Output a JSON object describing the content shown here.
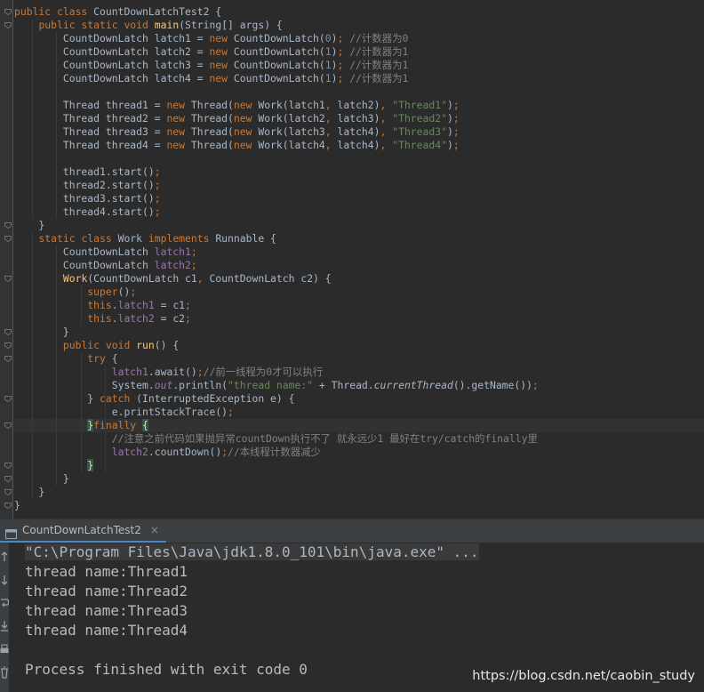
{
  "editor": {
    "lines": [
      [
        [
          "kw",
          "public class "
        ],
        [
          "t",
          "CountDownLatchTest2 {"
        ]
      ],
      [
        [
          "t",
          "    "
        ],
        [
          "kw",
          "public static void "
        ],
        [
          "fn",
          "main"
        ],
        [
          "t",
          "(String[] args) {"
        ]
      ],
      [
        [
          "t",
          "        CountDownLatch latch1 = "
        ],
        [
          "kw",
          "new "
        ],
        [
          "t",
          "CountDownLatch("
        ],
        [
          "num",
          "0"
        ],
        [
          "t",
          ")"
        ],
        [
          "kw",
          "; "
        ],
        [
          "cm",
          "//计数器为0"
        ]
      ],
      [
        [
          "t",
          "        CountDownLatch latch2 = "
        ],
        [
          "kw",
          "new "
        ],
        [
          "t",
          "CountDownLatch("
        ],
        [
          "num",
          "1"
        ],
        [
          "t",
          ")"
        ],
        [
          "kw",
          "; "
        ],
        [
          "cm",
          "//计数器为1"
        ]
      ],
      [
        [
          "t",
          "        CountDownLatch latch3 = "
        ],
        [
          "kw",
          "new "
        ],
        [
          "t",
          "CountDownLatch("
        ],
        [
          "num",
          "1"
        ],
        [
          "t",
          ")"
        ],
        [
          "kw",
          "; "
        ],
        [
          "cm",
          "//计数器为1"
        ]
      ],
      [
        [
          "t",
          "        CountDownLatch latch4 = "
        ],
        [
          "kw",
          "new "
        ],
        [
          "t",
          "CountDownLatch("
        ],
        [
          "num",
          "1"
        ],
        [
          "t",
          ")"
        ],
        [
          "kw",
          "; "
        ],
        [
          "cm",
          "//计数器为1"
        ]
      ],
      [],
      [
        [
          "t",
          "        Thread thread1 = "
        ],
        [
          "kw",
          "new "
        ],
        [
          "t",
          "Thread("
        ],
        [
          "kw",
          "new "
        ],
        [
          "t",
          "Work(latch1"
        ],
        [
          "kw",
          ", "
        ],
        [
          "t",
          "latch2)"
        ],
        [
          "kw",
          ", "
        ],
        [
          "str",
          "\"Thread1\""
        ],
        [
          "t",
          ")"
        ],
        [
          "kw",
          ";"
        ]
      ],
      [
        [
          "t",
          "        Thread thread2 = "
        ],
        [
          "kw",
          "new "
        ],
        [
          "t",
          "Thread("
        ],
        [
          "kw",
          "new "
        ],
        [
          "t",
          "Work(latch2"
        ],
        [
          "kw",
          ", "
        ],
        [
          "t",
          "latch3)"
        ],
        [
          "kw",
          ", "
        ],
        [
          "str",
          "\"Thread2\""
        ],
        [
          "t",
          ")"
        ],
        [
          "kw",
          ";"
        ]
      ],
      [
        [
          "t",
          "        Thread thread3 = "
        ],
        [
          "kw",
          "new "
        ],
        [
          "t",
          "Thread("
        ],
        [
          "kw",
          "new "
        ],
        [
          "t",
          "Work(latch3"
        ],
        [
          "kw",
          ", "
        ],
        [
          "t",
          "latch4)"
        ],
        [
          "kw",
          ", "
        ],
        [
          "str",
          "\"Thread3\""
        ],
        [
          "t",
          ")"
        ],
        [
          "kw",
          ";"
        ]
      ],
      [
        [
          "t",
          "        Thread thread4 = "
        ],
        [
          "kw",
          "new "
        ],
        [
          "t",
          "Thread("
        ],
        [
          "kw",
          "new "
        ],
        [
          "t",
          "Work(latch4"
        ],
        [
          "kw",
          ", "
        ],
        [
          "t",
          "latch4)"
        ],
        [
          "kw",
          ", "
        ],
        [
          "str",
          "\"Thread4\""
        ],
        [
          "t",
          ")"
        ],
        [
          "kw",
          ";"
        ]
      ],
      [],
      [
        [
          "t",
          "        thread1.start()"
        ],
        [
          "kw",
          ";"
        ]
      ],
      [
        [
          "t",
          "        thread2.start()"
        ],
        [
          "kw",
          ";"
        ]
      ],
      [
        [
          "t",
          "        thread3.start()"
        ],
        [
          "kw",
          ";"
        ]
      ],
      [
        [
          "t",
          "        thread4.start()"
        ],
        [
          "kw",
          ";"
        ]
      ],
      [
        [
          "t",
          "    }"
        ]
      ],
      [
        [
          "t",
          "    "
        ],
        [
          "kw",
          "static class "
        ],
        [
          "t",
          "Work "
        ],
        [
          "kw",
          "implements "
        ],
        [
          "t",
          "Runnable {"
        ]
      ],
      [
        [
          "t",
          "        CountDownLatch "
        ],
        [
          "fld",
          "latch1"
        ],
        [
          "kw",
          ";"
        ]
      ],
      [
        [
          "t",
          "        CountDownLatch "
        ],
        [
          "fld",
          "latch2"
        ],
        [
          "kw",
          ";"
        ]
      ],
      [
        [
          "t",
          "        "
        ],
        [
          "fn",
          "Work"
        ],
        [
          "t",
          "(CountDownLatch c1"
        ],
        [
          "kw",
          ", "
        ],
        [
          "t",
          "CountDownLatch c2) {"
        ]
      ],
      [
        [
          "t",
          "            "
        ],
        [
          "kw",
          "super"
        ],
        [
          "t",
          "()"
        ],
        [
          "kw",
          ";"
        ]
      ],
      [
        [
          "t",
          "            "
        ],
        [
          "kw",
          "this"
        ],
        [
          "t",
          "."
        ],
        [
          "fld",
          "latch1 "
        ],
        [
          "t",
          "= c1"
        ],
        [
          "kw",
          ";"
        ]
      ],
      [
        [
          "t",
          "            "
        ],
        [
          "kw",
          "this"
        ],
        [
          "t",
          "."
        ],
        [
          "fld",
          "latch2 "
        ],
        [
          "t",
          "= c2"
        ],
        [
          "kw",
          ";"
        ]
      ],
      [
        [
          "t",
          "        }"
        ]
      ],
      [
        [
          "t",
          "        "
        ],
        [
          "kw",
          "public void "
        ],
        [
          "fn",
          "run"
        ],
        [
          "t",
          "() {"
        ]
      ],
      [
        [
          "t",
          "            "
        ],
        [
          "kw",
          "try "
        ],
        [
          "t",
          "{"
        ]
      ],
      [
        [
          "t",
          "                "
        ],
        [
          "fld",
          "latch1"
        ],
        [
          "t",
          ".await()"
        ],
        [
          "kw",
          ";"
        ],
        [
          "cm",
          "//前一线程为0才可以执行"
        ]
      ],
      [
        [
          "t",
          "                System."
        ],
        [
          "stat",
          "out"
        ],
        [
          "t",
          ".println("
        ],
        [
          "str",
          "\"thread name:\" "
        ],
        [
          "t",
          "+ Thread."
        ],
        [
          "it",
          "currentThread"
        ],
        [
          "t",
          "().getName())"
        ],
        [
          "kw",
          ";"
        ]
      ],
      [
        [
          "t",
          "            } "
        ],
        [
          "kw",
          "catch "
        ],
        [
          "t",
          "(InterruptedException e) {"
        ]
      ],
      [
        [
          "t",
          "                e.printStackTrace()"
        ],
        [
          "kw",
          ";"
        ]
      ],
      [
        [
          "t",
          "            "
        ],
        [
          "brace",
          "}"
        ],
        [
          "kw",
          "finally "
        ],
        [
          "brace",
          "{"
        ]
      ],
      [
        [
          "t",
          "                "
        ],
        [
          "cm",
          "//注意之前代码如果抛异常countDown执行不了 就永远少1 最好在try/catch的finally里"
        ]
      ],
      [
        [
          "t",
          "                "
        ],
        [
          "fld",
          "latch2"
        ],
        [
          "t",
          ".countDown()"
        ],
        [
          "kw",
          ";"
        ],
        [
          "cm",
          "//本线程计数器减少"
        ]
      ],
      [
        [
          "t",
          "            "
        ],
        [
          "brace",
          "}"
        ]
      ],
      [
        [
          "t",
          "        }"
        ]
      ],
      [
        [
          "t",
          "    }"
        ]
      ],
      [
        [
          "t",
          "}"
        ]
      ]
    ],
    "current_line": 31
  },
  "run_panel": {
    "tab_label": "CountDownLatchTest2",
    "close_glyph": "×"
  },
  "console": {
    "command": "\"C:\\Program Files\\Java\\jdk1.8.0_101\\bin\\java.exe\" ...",
    "output": [
      "thread name:Thread1",
      "thread name:Thread2",
      "thread name:Thread3",
      "thread name:Thread4",
      "",
      "Process finished with exit code 0"
    ]
  },
  "watermark": "https://blog.csdn.net/caobin_study",
  "colors": {
    "background": "#2b2b2b",
    "keyword": "#cc7832",
    "method": "#ffc66d",
    "field": "#9876aa",
    "string": "#6a8759",
    "comment": "#808080",
    "number": "#6897bb",
    "text": "#a9b7c6"
  }
}
